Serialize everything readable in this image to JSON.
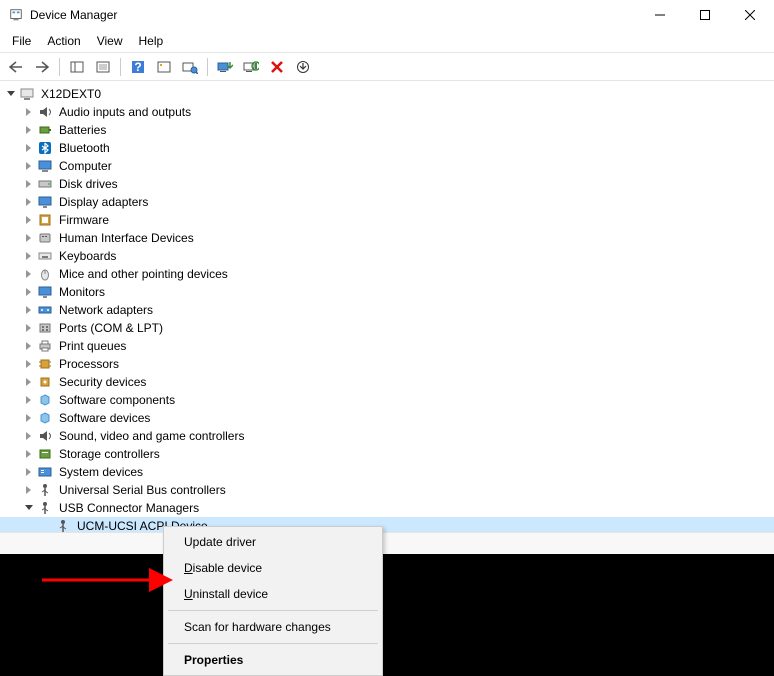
{
  "window": {
    "title": "Device Manager"
  },
  "menubar": {
    "file": "File",
    "action": "Action",
    "view": "View",
    "help": "Help"
  },
  "root": {
    "label": "X12DEXT0"
  },
  "categories": [
    {
      "label": "Audio inputs and outputs",
      "icon": "speaker"
    },
    {
      "label": "Batteries",
      "icon": "battery"
    },
    {
      "label": "Bluetooth",
      "icon": "bluetooth"
    },
    {
      "label": "Computer",
      "icon": "computer"
    },
    {
      "label": "Disk drives",
      "icon": "disk"
    },
    {
      "label": "Display adapters",
      "icon": "display"
    },
    {
      "label": "Firmware",
      "icon": "firmware"
    },
    {
      "label": "Human Interface Devices",
      "icon": "hid"
    },
    {
      "label": "Keyboards",
      "icon": "keyboard"
    },
    {
      "label": "Mice and other pointing devices",
      "icon": "mouse"
    },
    {
      "label": "Monitors",
      "icon": "monitor"
    },
    {
      "label": "Network adapters",
      "icon": "network"
    },
    {
      "label": "Ports (COM & LPT)",
      "icon": "port"
    },
    {
      "label": "Print queues",
      "icon": "printer"
    },
    {
      "label": "Processors",
      "icon": "cpu"
    },
    {
      "label": "Security devices",
      "icon": "security"
    },
    {
      "label": "Software components",
      "icon": "software"
    },
    {
      "label": "Software devices",
      "icon": "software"
    },
    {
      "label": "Sound, video and game controllers",
      "icon": "sound"
    },
    {
      "label": "Storage controllers",
      "icon": "storage"
    },
    {
      "label": "System devices",
      "icon": "system"
    },
    {
      "label": "Universal Serial Bus controllers",
      "icon": "usb"
    }
  ],
  "expanded_category": {
    "label": "USB Connector Managers",
    "icon": "usb",
    "child": {
      "label": "UCM-UCSI ACPI Device",
      "icon": "usb"
    }
  },
  "context_menu": {
    "update": "Update driver",
    "disable": "Disable device",
    "uninstall": "Uninstall device",
    "scan": "Scan for hardware changes",
    "properties": "Properties"
  },
  "annotation": {
    "arrow_color": "#ff0000"
  }
}
